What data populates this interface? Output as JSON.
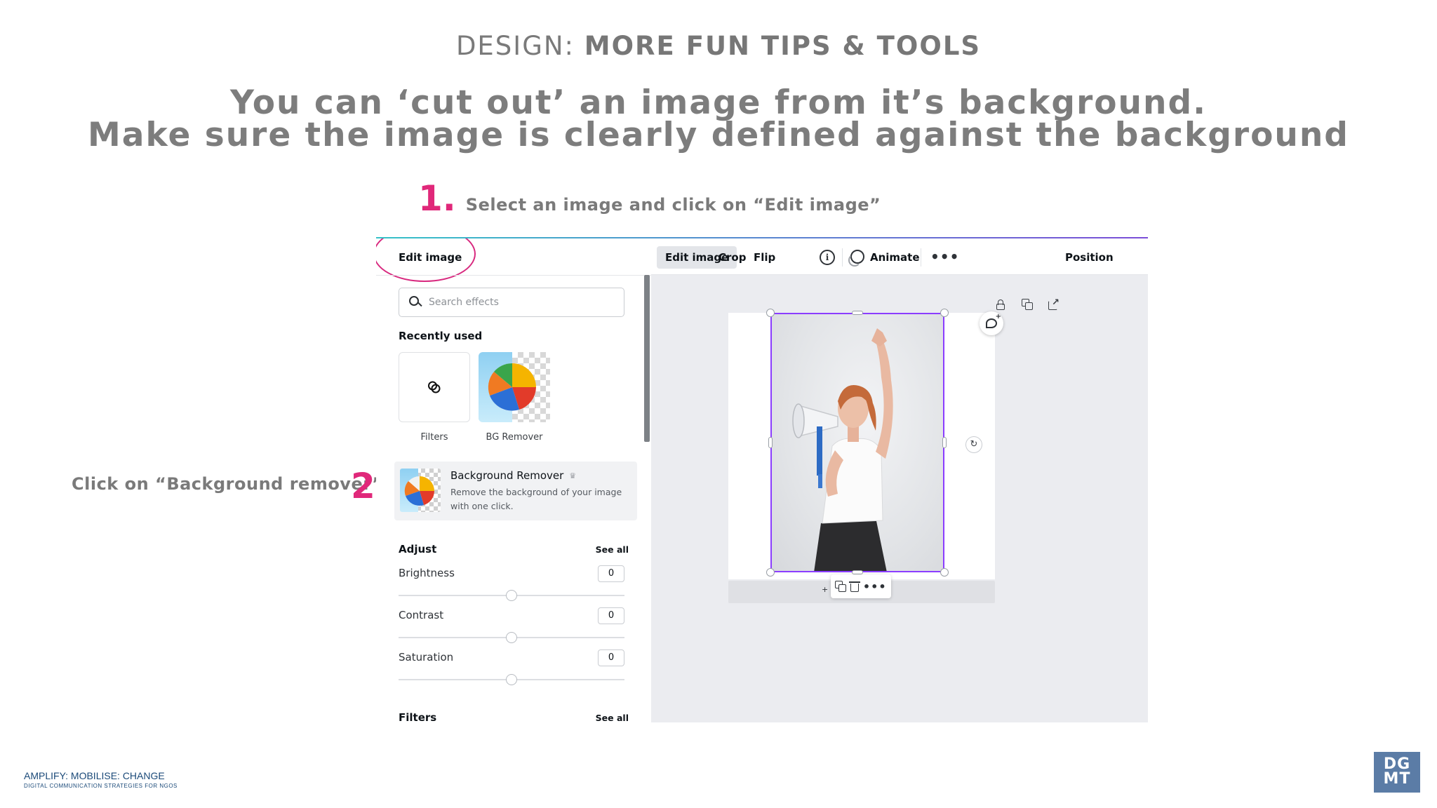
{
  "slide": {
    "title_light": "DESIGN: ",
    "title_bold": "MORE FUN TIPS & TOOLS",
    "headline_line1": "You can ‘cut out’ an image from it’s background.",
    "headline_line2": "Make sure the image is clearly defined against the background",
    "step1_num": "1.",
    "step1_text": "Select an image and click on “Edit image”",
    "step2_num": "2.",
    "step2_text": "Click on “Background remover”"
  },
  "panel": {
    "header": "Edit image",
    "search_placeholder": "Search effects",
    "recently_used": "Recently used",
    "tiles": [
      {
        "label": "Filters",
        "icon": "filters-icon"
      },
      {
        "label": "BG Remover",
        "icon": "beach-ball-thumbnail"
      }
    ],
    "bg_remover": {
      "title": "Background Remover",
      "description": "Remove the background of your image with one click.",
      "icon": "crown-icon"
    },
    "adjust": {
      "label": "Adjust",
      "see_all": "See all",
      "items": [
        {
          "label": "Brightness",
          "value": "0"
        },
        {
          "label": "Contrast",
          "value": "0"
        },
        {
          "label": "Saturation",
          "value": "0"
        }
      ]
    },
    "filters": {
      "label": "Filters",
      "see_all": "See all"
    }
  },
  "toolbar": {
    "edit_image": "Edit image",
    "crop": "Crop",
    "flip": "Flip",
    "info": "i",
    "animate": "Animate",
    "more": "•••",
    "position": "Position"
  },
  "canvas": {
    "floating_more": "•••",
    "rotate_icon": "↻"
  },
  "footer": {
    "brand": "AMPLIFY: MOBILISE: CHANGE",
    "subtitle": "DIGITAL COMMUNICATION STRATEGIES FOR NGOS",
    "logo_line1": "DG",
    "logo_line2": "MT"
  },
  "colors": {
    "accent_pink": "#e0287a",
    "selection_purple": "#8b3dff",
    "logo_blue": "#5b7ca6",
    "brand_navy": "#1b4a79"
  }
}
